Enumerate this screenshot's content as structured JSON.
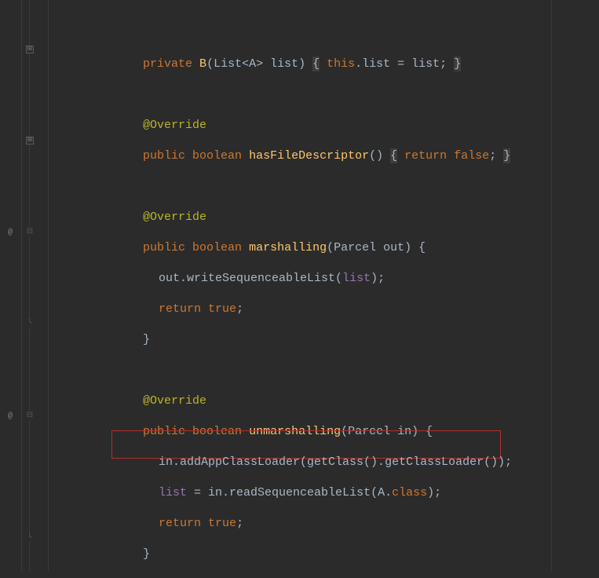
{
  "code": {
    "line1": {
      "private": "private",
      "method": "B",
      "params": "(List<A> list)",
      "brace_open": "{",
      "this": "this",
      "dot_list_eq": ".list = list;",
      "brace_close": "}"
    },
    "line2": {
      "annotation": "@Override"
    },
    "line3": {
      "public": "public",
      "boolean": "boolean",
      "method": "hasFileDescriptor",
      "parens": "()",
      "brace_open": "{",
      "return": "return",
      "false": "false",
      "semicolon": ";",
      "brace_close": "}"
    },
    "line4": {
      "annotation": "@Override"
    },
    "line5": {
      "public": "public",
      "boolean": "boolean",
      "method": "marshalling",
      "params": "(Parcel out) {"
    },
    "line6": {
      "text_prefix": "out.writeSequenceableList(",
      "field": "list",
      "text_suffix": ");"
    },
    "line7": {
      "return": "return",
      "true": "true",
      "semicolon": ";"
    },
    "line8": {
      "brace": "}"
    },
    "line9": {
      "annotation": "@Override"
    },
    "line10": {
      "public": "public",
      "boolean": "boolean",
      "method": "unmarshalling",
      "params": "(Parcel in) {"
    },
    "line11": {
      "text": "in.addAppClassLoader(getClass().getClassLoader());"
    },
    "line12": {
      "prefix": "list",
      "middle": " = in.readSequenceableList(A.",
      "class": "class",
      "suffix": ");"
    },
    "line13": {
      "return": "return",
      "true": "true",
      "semicolon": ";"
    },
    "line14": {
      "brace": "}"
    }
  },
  "gutter": {
    "at_symbol": "@",
    "plus": "⊞",
    "minus": "⊟",
    "end": "⌐"
  }
}
